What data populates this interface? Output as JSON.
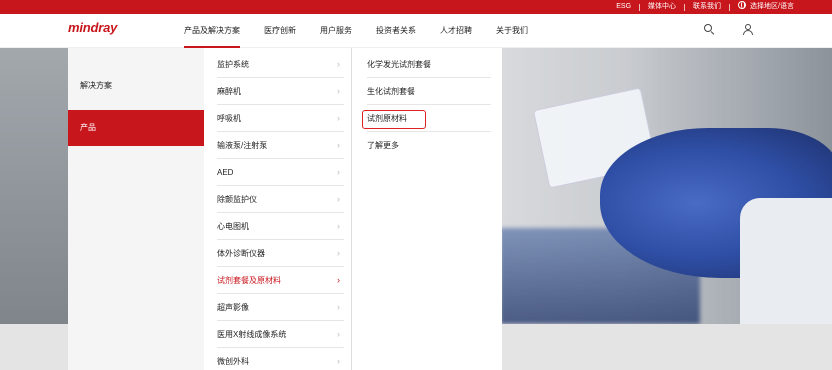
{
  "topbar": {
    "links": [
      "ESG",
      "媒体中心",
      "联系我们",
      "选择地区/语言"
    ]
  },
  "brand": {
    "logo": "mindray",
    "accent": "#c8161d"
  },
  "nav": {
    "items": [
      "产品及解决方案",
      "医疗创新",
      "用户服务",
      "投资者关系",
      "人才招聘",
      "关于我们"
    ],
    "active_index": 0
  },
  "menu": {
    "col1": [
      "解决方案",
      "产品"
    ],
    "col1_active": "产品",
    "col2": [
      "监护系统",
      "麻醉机",
      "呼吸机",
      "输液泵/注射泵",
      "AED",
      "除颤监护仪",
      "心电图机",
      "体外诊断仪器",
      "试剂套餐及原材料",
      "超声影像",
      "医用X射线成像系统",
      "微创外科"
    ],
    "col2_active": "试剂套餐及原材料",
    "col3": [
      "化学发光试剂套餐",
      "生化试剂套餐",
      "试剂原材料",
      "了解更多"
    ],
    "col3_highlighted": "试剂原材料"
  },
  "icons": {
    "search": "search-icon",
    "user": "user-icon",
    "globe": "globe-icon",
    "chevron": "chevron-right-icon"
  }
}
